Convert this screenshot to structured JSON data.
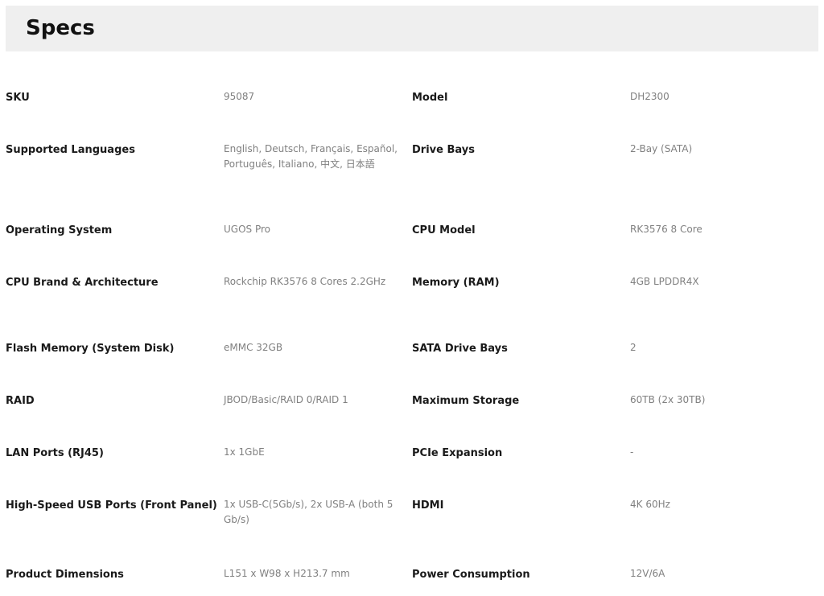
{
  "section": {
    "title": "Specs"
  },
  "rows": [
    {
      "left": {
        "label": "SKU",
        "value": "95087"
      },
      "right": {
        "label": "Model",
        "value": "DH2300"
      }
    },
    {
      "left": {
        "label": "Supported Languages",
        "value": "English, Deutsch, Français, Español, Português, Italiano, 中文, 日本語"
      },
      "right": {
        "label": "Drive Bays",
        "value": "2-Bay (SATA)"
      }
    },
    {
      "left": {
        "label": "Operating System",
        "value": "UGOS Pro"
      },
      "right": {
        "label": "CPU Model",
        "value": "RK3576 8 Core"
      }
    },
    {
      "left": {
        "label": "CPU Brand & Architecture",
        "value": "Rockchip RK3576 8 Cores 2.2GHz"
      },
      "right": {
        "label": "Memory (RAM)",
        "value": "4GB LPDDR4X"
      }
    },
    {
      "left": {
        "label": "Flash Memory (System Disk)",
        "value": "eMMC 32GB"
      },
      "right": {
        "label": "SATA Drive Bays",
        "value": "2"
      }
    },
    {
      "left": {
        "label": "RAID",
        "value": "JBOD/Basic/RAID 0/RAID 1"
      },
      "right": {
        "label": "Maximum Storage",
        "value": "60TB (2x 30TB)"
      }
    },
    {
      "left": {
        "label": "LAN Ports (RJ45)",
        "value": "1x 1GbE"
      },
      "right": {
        "label": "PCIe Expansion",
        "value": "-"
      }
    },
    {
      "left": {
        "label": "High-Speed USB Ports (Front Panel)",
        "value": "1x USB-C(5Gb/s), 2x USB-A (both 5Gb/s)"
      },
      "right": {
        "label": "HDMI",
        "value": "4K 60Hz"
      }
    },
    {
      "left": {
        "label": "Product Dimensions",
        "value": "L151 x W98 x H213.7 mm"
      },
      "right": {
        "label": "Power Consumption",
        "value": "12V/6A"
      }
    }
  ]
}
